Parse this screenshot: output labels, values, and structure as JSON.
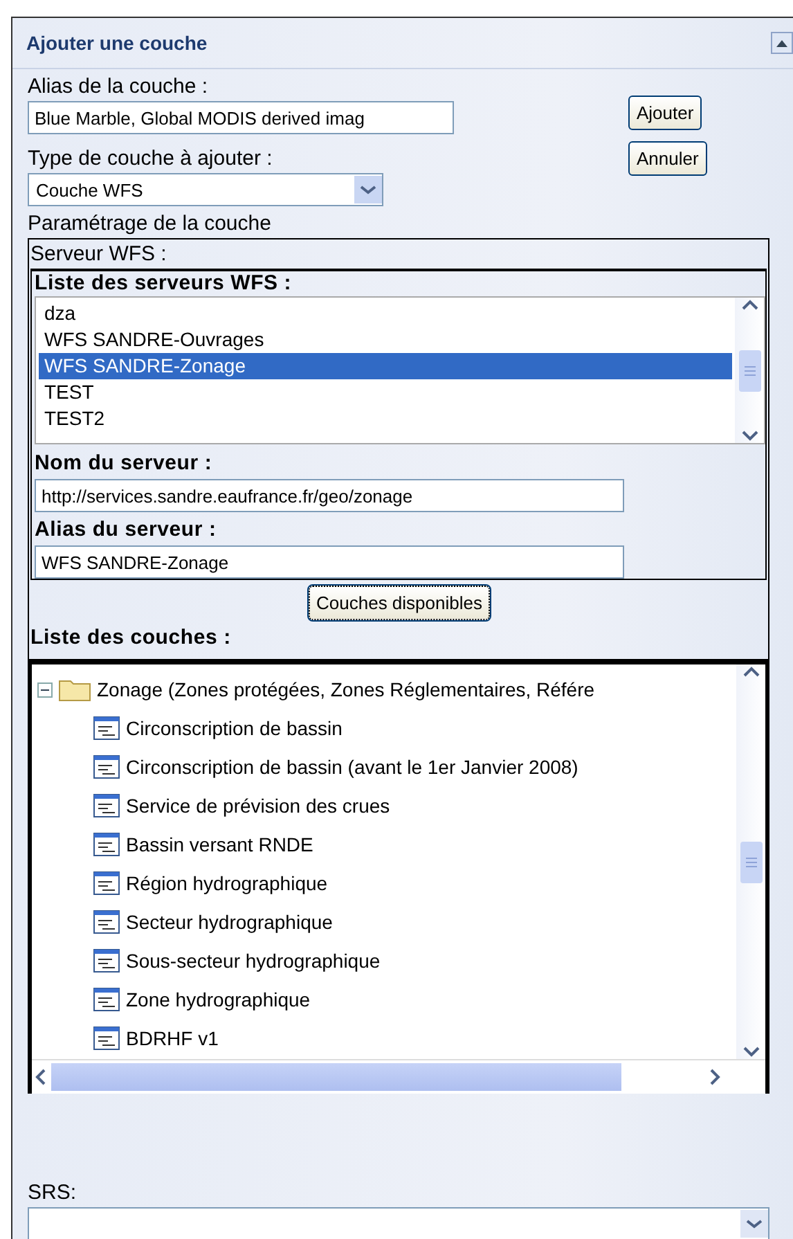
{
  "panel": {
    "title": "Ajouter une couche",
    "expanded": true
  },
  "alias": {
    "label": "Alias de la couche :",
    "value": "Blue Marble, Global MODIS derived imag"
  },
  "buttons": [
    "Ajouter",
    "Annuler"
  ],
  "type": {
    "label": "Type de couche à ajouter :",
    "value": "Couche WFS"
  },
  "settings_title": "Paramétrage de la couche",
  "server_section": {
    "title": "Serveur WFS :",
    "list_label": "Liste des serveurs WFS :",
    "servers": [
      {
        "label": "dza",
        "selected": false
      },
      {
        "label": "WFS SANDRE-Ouvrages",
        "selected": false
      },
      {
        "label": "WFS SANDRE-Zonage",
        "selected": true
      },
      {
        "label": "TEST",
        "selected": false
      },
      {
        "label": "TEST2",
        "selected": false
      }
    ],
    "name_label": "Nom du serveur :",
    "name_value": "http://services.sandre.eaufrance.fr/geo/zonage",
    "alias_label": "Alias du serveur :",
    "alias_value": "WFS SANDRE-Zonage"
  },
  "load_button": "Couches disponibles",
  "layers": {
    "label": "Liste des couches :",
    "tree": [
      {
        "label": "Zonage (Zones protégées, Zones Réglementaires, Référe",
        "kind": "folder",
        "expanded": true,
        "children": [
          {
            "label": "Circonscription de bassin",
            "kind": "layer"
          },
          {
            "label": "Circonscription de bassin (avant le 1er Janvier 2008)",
            "kind": "layer"
          },
          {
            "label": "Service de prévision des crues",
            "kind": "layer"
          },
          {
            "label": "Bassin versant RNDE",
            "kind": "layer"
          },
          {
            "label": "Région hydrographique",
            "kind": "layer"
          },
          {
            "label": "Secteur hydrographique",
            "kind": "layer"
          },
          {
            "label": "Sous-secteur hydrographique",
            "kind": "layer"
          },
          {
            "label": "Zone hydrographique",
            "kind": "layer"
          },
          {
            "label": "BDRHF v1",
            "kind": "layer"
          }
        ]
      }
    ]
  },
  "srs": {
    "label": "SRS:"
  }
}
